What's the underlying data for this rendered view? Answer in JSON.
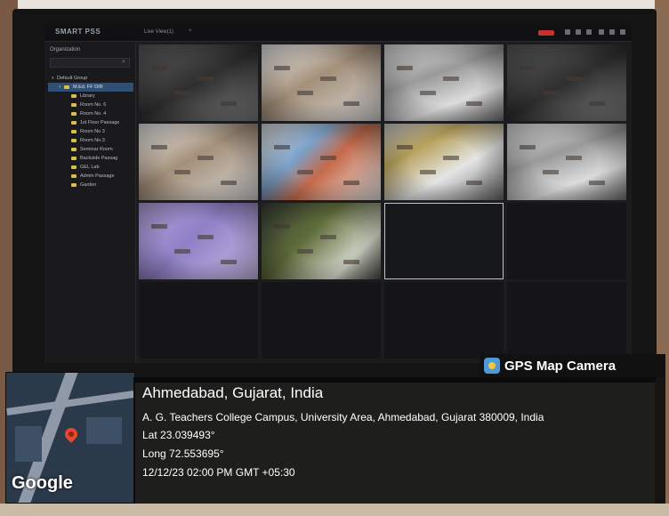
{
  "app": {
    "title": "SMART PSS",
    "tab_label": "Live View(1)",
    "tab_close": "×"
  },
  "sidebar": {
    "header": "Organization",
    "search_icon": "⌕",
    "group_label": "Default Group",
    "root_label": "M.Ed. FF DIR",
    "items": [
      "Library",
      "Room No. 6",
      "Room No. 4",
      "1st Floor Passage",
      "Room No 3",
      "Room No.3",
      "Seminar Room",
      "Backside Passag",
      "GEL Lab",
      "Admin Passage",
      "Garden"
    ]
  },
  "grid": {
    "cells": [
      {
        "style": "cam-dark"
      },
      {
        "style": "cam-warm"
      },
      {
        "style": "cam-gray"
      },
      {
        "style": "cam-dark"
      },
      {
        "style": "cam-warm"
      },
      {
        "style": "cam-colorful"
      },
      {
        "style": "cam-yellow"
      },
      {
        "style": "cam-gray"
      },
      {
        "style": "cam-purple"
      },
      {
        "style": "cam-green"
      },
      {
        "style": "selected-cell"
      },
      {
        "style": "empty"
      },
      {
        "style": "empty"
      },
      {
        "style": "empty"
      },
      {
        "style": "empty"
      },
      {
        "style": "empty"
      }
    ]
  },
  "gps": {
    "brand": "GPS Map Camera",
    "city": "Ahmedabad, Gujarat, India",
    "address": "A. G. Teachers College Campus, University Area, Ahmedabad, Gujarat 380009, India",
    "lat": "Lat 23.039493°",
    "long": "Long 72.553695°",
    "datetime": "12/12/23 02:00 PM GMT +05:30",
    "map_label": "Google"
  },
  "colors": {
    "accent": "#2f4f74",
    "record": "#c8302c",
    "pin": "#e4472e"
  }
}
